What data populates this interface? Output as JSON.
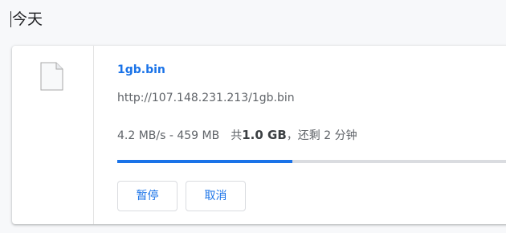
{
  "section": {
    "date_header": "今天"
  },
  "download": {
    "icon": "file-icon",
    "file_name": "1gb.bin",
    "url": "http://107.148.231.213/1gb.bin",
    "status": {
      "speed_and_received": "4.2 MB/s - 459 MB",
      "total_prefix": "共",
      "total_size": "1.0 GB",
      "remaining": "，还剩 2 分钟"
    },
    "progress": 0.45,
    "actions": {
      "pause_label": "暂停",
      "cancel_label": "取消"
    }
  },
  "colors": {
    "accent": "#1a73e8",
    "progress_track": "#dadce0",
    "page_background": "#f7f8fa"
  }
}
